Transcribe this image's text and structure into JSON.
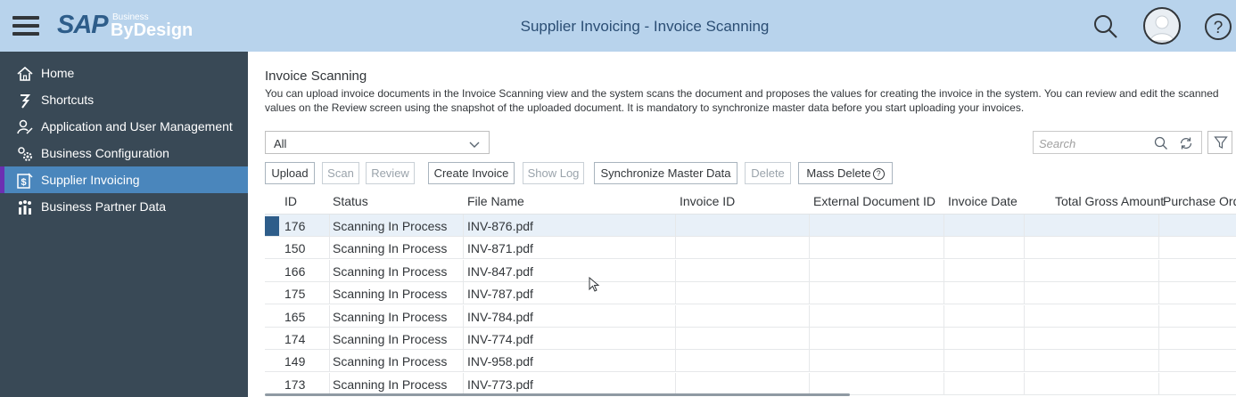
{
  "header": {
    "logo_main": "SAP",
    "logo_super": "Business",
    "logo_product": "ByDesign",
    "title": "Supplier Invoicing - Invoice Scanning"
  },
  "icons": {
    "menu": "hamburger-menu-icon",
    "search": "search-icon",
    "user": "user-avatar",
    "help": "help-icon",
    "refresh": "refresh-icon",
    "filter": "filter-icon",
    "dropdown": "chevron-down-icon"
  },
  "sidebar": {
    "items": [
      {
        "label": "Home",
        "icon": "home-icon",
        "active": false
      },
      {
        "label": "Shortcuts",
        "icon": "shortcut-icon",
        "active": false
      },
      {
        "label": "Application and User Management",
        "icon": "user-management-icon",
        "active": false
      },
      {
        "label": "Business Configuration",
        "icon": "configuration-icon",
        "active": false
      },
      {
        "label": "Supplier Invoicing",
        "icon": "invoice-icon",
        "active": true
      },
      {
        "label": "Business Partner Data",
        "icon": "partner-icon",
        "active": false
      }
    ]
  },
  "main": {
    "title": "Invoice Scanning",
    "description": "You can upload invoice documents in the Invoice Scanning view and the system scans the document and proposes the values for creating the invoice in the system. You can review and edit the scanned values on the Review screen using the snapshot of the uploaded document. It is mandatory to synchronize master data before you start uploading your invoices.",
    "filter_value": "All",
    "search_placeholder": "Search"
  },
  "toolbar": {
    "upload": "Upload",
    "scan": "Scan",
    "review": "Review",
    "create_invoice": "Create Invoice",
    "show_log": "Show Log",
    "synchronize": "Synchronize Master Data",
    "delete": "Delete",
    "mass_delete": "Mass Delete"
  },
  "table": {
    "columns": [
      "ID",
      "Status",
      "File Name",
      "Invoice ID",
      "External Document ID",
      "Invoice Date",
      "Total Gross Amount",
      "Purchase Ord"
    ],
    "rows": [
      [
        "176",
        "Scanning In Process",
        "INV-876.pdf",
        "",
        "",
        "",
        "",
        ""
      ],
      [
        "150",
        "Scanning In Process",
        "INV-871.pdf",
        "",
        "",
        "",
        "",
        ""
      ],
      [
        "166",
        "Scanning In Process",
        "INV-847.pdf",
        "",
        "",
        "",
        "",
        ""
      ],
      [
        "175",
        "Scanning In Process",
        "INV-787.pdf",
        "",
        "",
        "",
        "",
        ""
      ],
      [
        "165",
        "Scanning In Process",
        "INV-784.pdf",
        "",
        "",
        "",
        "",
        ""
      ],
      [
        "174",
        "Scanning In Process",
        "INV-774.pdf",
        "",
        "",
        "",
        "",
        ""
      ],
      [
        "149",
        "Scanning In Process",
        "INV-958.pdf",
        "",
        "",
        "",
        "",
        ""
      ],
      [
        "173",
        "Scanning In Process",
        "INV-773.pdf",
        "",
        "",
        "",
        "",
        ""
      ]
    ],
    "selected_row": 0
  },
  "colors": {
    "header_bg": "#b8d3ec",
    "sidebar_bg": "#394956",
    "sidebar_active": "#4a86bc",
    "selection": "#2e5d8a"
  }
}
